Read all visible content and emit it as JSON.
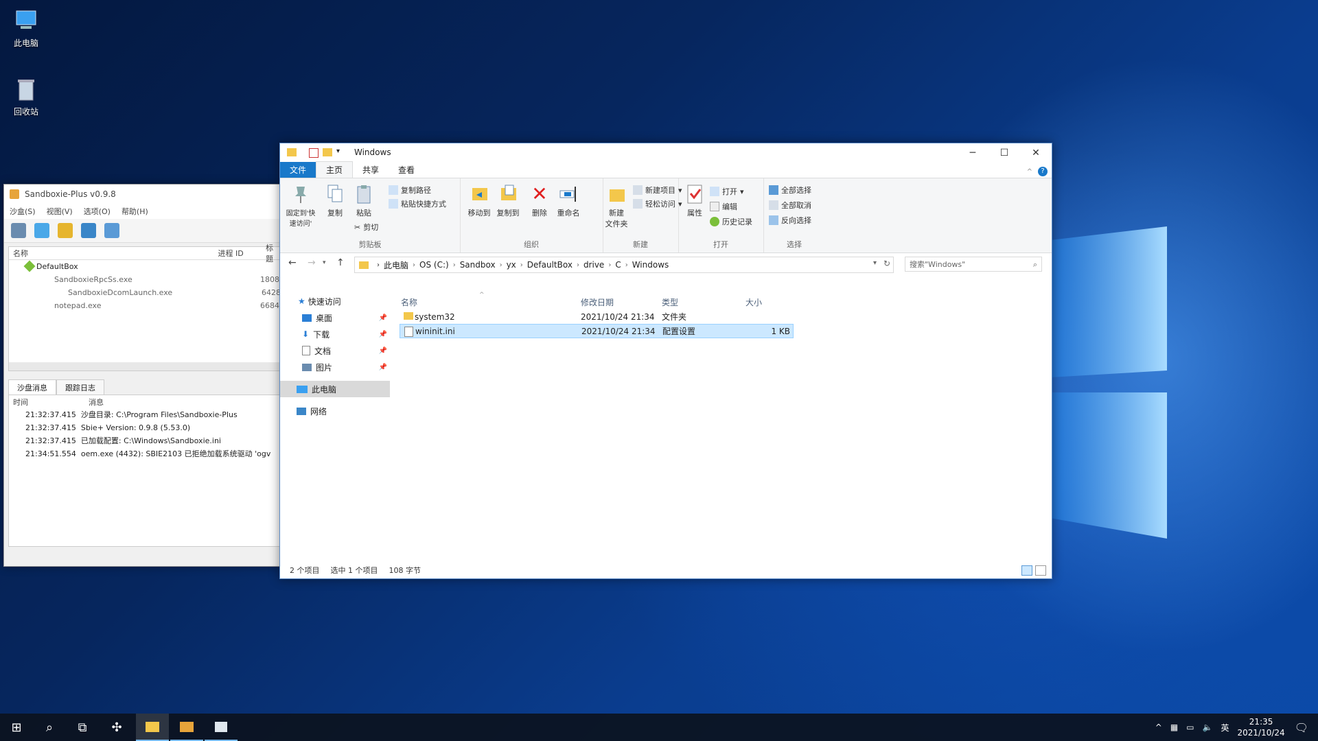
{
  "desktop": {
    "icons": [
      {
        "label": "此电脑",
        "icon": "computer-icon"
      },
      {
        "label": "回收站",
        "icon": "recycle-bin-icon"
      }
    ]
  },
  "sandboxie": {
    "title": "Sandboxie-Plus v0.9.8",
    "menu": [
      "沙盒(S)",
      "视图(V)",
      "选项(O)",
      "帮助(H)"
    ],
    "columns": [
      "名称",
      "进程 ID",
      "标题"
    ],
    "tree": [
      {
        "name": "DefaultBox",
        "pid": ""
      },
      {
        "name": "SandboxieRpcSs.exe",
        "pid": "1808"
      },
      {
        "name": "SandboxieDcomLaunch.exe",
        "pid": "6428"
      },
      {
        "name": "notepad.exe",
        "pid": "6684"
      }
    ],
    "log_tabs": [
      "沙盘消息",
      "跟踪日志"
    ],
    "log_columns": [
      "时间",
      "消息"
    ],
    "log": [
      {
        "time": "21:32:37.415",
        "msg": "沙盘目录: C:\\Program Files\\Sandboxie-Plus"
      },
      {
        "time": "21:32:37.415",
        "msg": "Sbie+ Version: 0.9.8 (5.53.0)"
      },
      {
        "time": "21:32:37.415",
        "msg": "已加载配置: C:\\Windows\\Sandboxie.ini"
      },
      {
        "time": "21:34:51.554",
        "msg": "oem.exe (4432): SBIE2103 已拒绝加载系统驱动 'ogv"
      }
    ]
  },
  "explorer": {
    "title": "Windows",
    "tabs": [
      "文件",
      "主页",
      "共享",
      "查看"
    ],
    "ribbon": {
      "clipboard": {
        "pin": "固定到'快速访问'",
        "copy": "复制",
        "paste": "粘贴",
        "copy_path": "复制路径",
        "paste_shortcut": "粘贴快捷方式",
        "cut": "剪切",
        "label": "剪贴板"
      },
      "organize": {
        "move_to": "移动到",
        "copy_to": "复制到",
        "delete": "删除",
        "rename": "重命名",
        "label": "组织"
      },
      "new": {
        "new_folder": "新建\n文件夹",
        "new_item": "新建项目",
        "easy_access": "轻松访问",
        "label": "新建"
      },
      "open": {
        "properties": "属性",
        "open": "打开",
        "edit": "编辑",
        "history": "历史记录",
        "label": "打开"
      },
      "select": {
        "select_all": "全部选择",
        "select_none": "全部取消",
        "invert": "反向选择",
        "label": "选择"
      }
    },
    "breadcrumb": [
      "此电脑",
      "OS (C:)",
      "Sandbox",
      "yx",
      "DefaultBox",
      "drive",
      "C",
      "Windows"
    ],
    "search_placeholder": "搜索\"Windows\"",
    "nav": [
      {
        "label": "快速访问",
        "icon": "star-icon"
      },
      {
        "label": "桌面",
        "icon": "desktop-icon"
      },
      {
        "label": "下载",
        "icon": "download-icon"
      },
      {
        "label": "文档",
        "icon": "document-icon"
      },
      {
        "label": "图片",
        "icon": "picture-icon"
      },
      {
        "label": "此电脑",
        "icon": "computer-icon"
      },
      {
        "label": "网络",
        "icon": "network-icon"
      }
    ],
    "columns": [
      "名称",
      "修改日期",
      "类型",
      "大小"
    ],
    "files": [
      {
        "name": "system32",
        "date": "2021/10/24 21:34",
        "type": "文件夹",
        "size": ""
      },
      {
        "name": "wininit.ini",
        "date": "2021/10/24 21:34",
        "type": "配置设置",
        "size": "1 KB"
      }
    ],
    "status": {
      "count": "2 个项目",
      "selected": "选中 1 个项目",
      "size": "108 字节"
    }
  },
  "taskbar": {
    "ime": "英",
    "time": "21:35",
    "date": "2021/10/24"
  }
}
